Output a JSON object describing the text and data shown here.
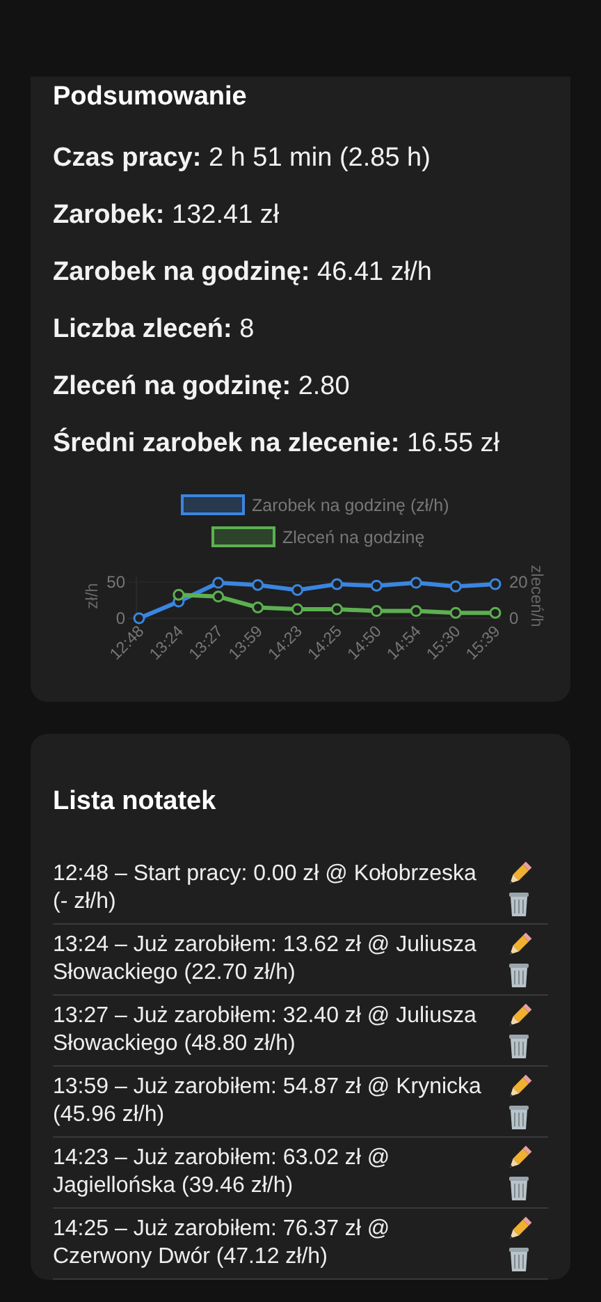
{
  "summary": {
    "title": "Podsumowanie",
    "stats": [
      {
        "label": "Czas pracy:",
        "value": "2 h 51 min (2.85 h)"
      },
      {
        "label": "Zarobek:",
        "value": "132.41 zł"
      },
      {
        "label": "Zarobek na godzinę:",
        "value": "46.41 zł/h"
      },
      {
        "label": "Liczba zleceń:",
        "value": "8"
      },
      {
        "label": "Zleceń na godzinę:",
        "value": "2.80"
      },
      {
        "label": "Średni zarobek na zlecenie:",
        "value": "16.55 zł"
      }
    ],
    "chart_data": {
      "type": "line",
      "ylabel": "zł/h",
      "y2label": "zleceń/h",
      "legend": "top",
      "ylim": [
        0,
        50
      ],
      "y2lim": [
        0,
        20
      ],
      "yticks": [
        0,
        50
      ],
      "y2ticks": [
        0,
        20
      ],
      "categories": [
        "12:48",
        "13:24",
        "13:27",
        "13:59",
        "14:23",
        "14:25",
        "14:50",
        "14:54",
        "15:30",
        "15:39"
      ],
      "series": [
        {
          "name": "Zarobek na godzinę (zł/h)",
          "color": "#3a86e0",
          "marker": "circle",
          "values": [
            0,
            23,
            49,
            46,
            39,
            47,
            45,
            49,
            44,
            47
          ]
        },
        {
          "name": "Zleceń na godzinę",
          "color": "#5cb050",
          "marker": "circle",
          "axis": "y2",
          "values": [
            null,
            13,
            12,
            6,
            5,
            5,
            4,
            4,
            3,
            3
          ]
        }
      ]
    }
  },
  "notes": {
    "title": "Lista notatek",
    "items": [
      {
        "text": "12:48 – Start pracy: 0.00 zł @ Kołobrzeska (- zł/h)"
      },
      {
        "text": "13:24 – Już zarobiłem: 13.62 zł @ Juliusza Słowackiego (22.70 zł/h)"
      },
      {
        "text": "13:27 – Już zarobiłem: 32.40 zł @ Juliusza Słowackiego (48.80 zł/h)"
      },
      {
        "text": "13:59 – Już zarobiłem: 54.87 zł @ Krynicka (45.96 zł/h)"
      },
      {
        "text": "14:23 – Już zarobiłem: 63.02 zł @ Jagiellońska (39.46 zł/h)"
      },
      {
        "text": "14:25 – Już zarobiłem: 76.37 zł @ Czerwony Dwór (47.12 zł/h)"
      }
    ]
  }
}
